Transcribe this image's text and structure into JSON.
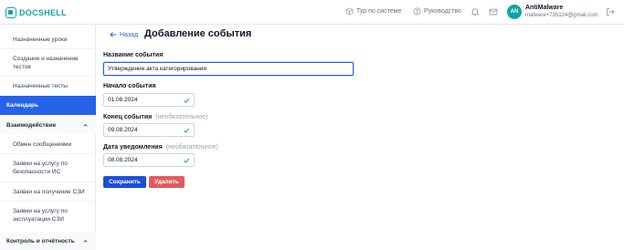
{
  "header": {
    "logo_text": "DOCSHELL",
    "tour_label": "Тур по системе",
    "guide_label": "Руководство",
    "user_initials": "AN",
    "user_name": "AntiMalware",
    "user_email": "malware+735124@gmail.com"
  },
  "sidebar": {
    "items": [
      {
        "label": "Назначенные уроки"
      },
      {
        "label": "Создание и назначение тестов"
      },
      {
        "label": "Назначенные тесты"
      },
      {
        "label": "Календарь"
      }
    ],
    "sections": [
      {
        "label": "Взаимодействие"
      },
      {
        "label": "Контроль и отчётность"
      }
    ],
    "sub_items": [
      {
        "label": "Обмен сообщениями"
      },
      {
        "label": "Заявки на услугу по безопасности ИС"
      },
      {
        "label": "Заявки на получение СЗИ"
      },
      {
        "label": "Заявки на услугу по эксплуатации СЗИ"
      }
    ]
  },
  "main": {
    "back_label": "Назад",
    "title": "Добавление события",
    "fields": {
      "name": {
        "label": "Название события",
        "value": "Утверждение акта категорирования"
      },
      "start": {
        "label": "Начало события",
        "value": "01.08.2024"
      },
      "end": {
        "label": "Конец события",
        "optional": "(необязательное)",
        "value": "09.08.2024"
      },
      "notify": {
        "label": "Дата уведомления",
        "optional": "(необязательное)",
        "value": "08.08.2024"
      }
    },
    "save_label": "Сохранить",
    "delete_label": "Удалить"
  },
  "colors": {
    "accent": "#2563eb",
    "brand": "#0ea5a4",
    "danger": "#e05c5c",
    "success": "#22c55e"
  }
}
